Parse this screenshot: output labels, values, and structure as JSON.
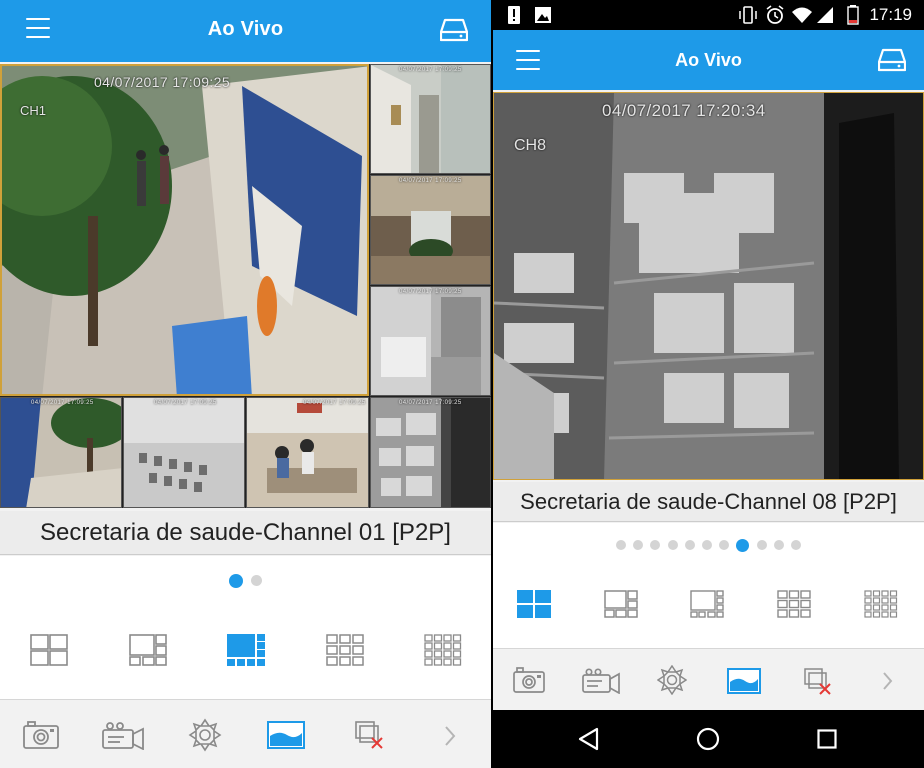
{
  "left_screen": {
    "title": "Ao Vivo",
    "main_channel_label": "CH1",
    "main_timestamp": "04/07/2017 17:09:25",
    "thumb_timestamps": [
      "04/07/2017 17:09:25",
      "04/07/2017 17:09:25",
      "04/07/2017 17:09:25",
      "04/07/2017 17:09:25",
      "04/07/2017 17:09:25",
      "04/07/2017 17:09:25",
      "04/07/2017 17:09:25"
    ],
    "caption": "Secretaria de saude-Channel 01 [P2P]",
    "page_dots": 2,
    "active_dot": 0
  },
  "right_screen": {
    "clock": "17:19",
    "title": "Ao Vivo",
    "channel_label": "CH8",
    "timestamp": "04/07/2017 17:20:34",
    "caption": "Secretaria de saude-Channel 08 [P2P]",
    "page_dots": 11,
    "active_dot": 7
  },
  "colors": {
    "accent": "#1e9ae8",
    "selected_border": "#d0a13a",
    "icon_gray": "#8a8a8a",
    "record_x": "#e53935"
  },
  "icons": {
    "menu": "hamburger-icon",
    "storage": "hard-drive-icon",
    "snapshot": "camera-icon",
    "record": "video-camera-icon",
    "ptz": "ptz-control-icon",
    "quality": "image-quality-icon",
    "close_all": "close-all-windows-icon",
    "next": "chevron-right-icon"
  }
}
